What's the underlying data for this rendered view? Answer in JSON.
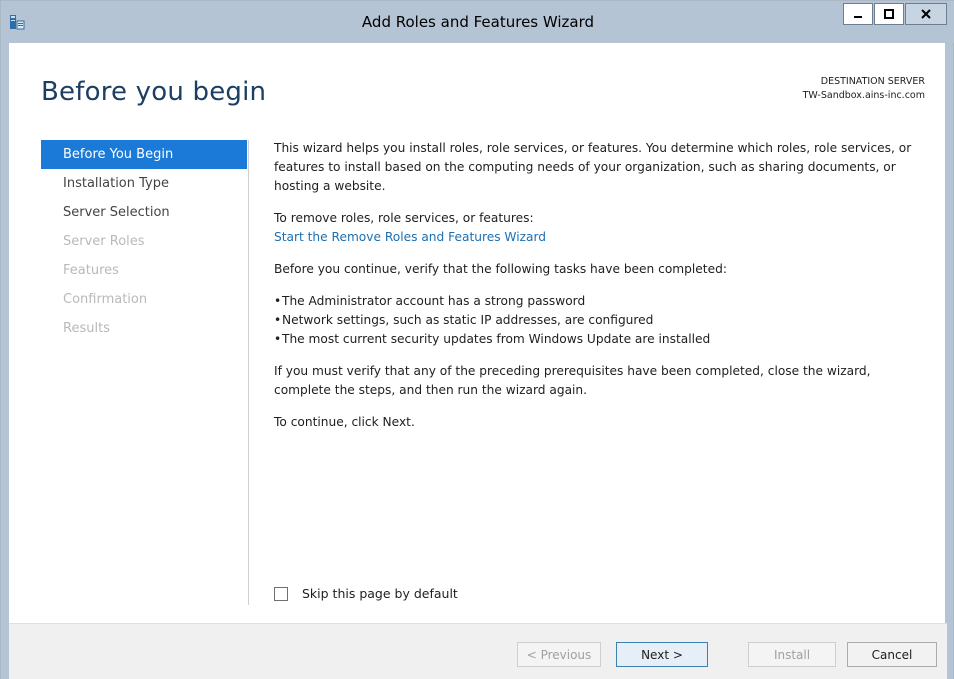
{
  "window": {
    "title": "Add Roles and Features Wizard",
    "controls": {
      "minimize": "minimize",
      "maximize": "maximize",
      "close": "close"
    }
  },
  "page": {
    "title": "Before you begin",
    "destination_label": "DESTINATION SERVER",
    "destination_server": "TW-Sandbox.ains-inc.com"
  },
  "nav": {
    "items": [
      {
        "label": "Before You Begin",
        "state": "active"
      },
      {
        "label": "Installation Type",
        "state": "enabled"
      },
      {
        "label": "Server Selection",
        "state": "enabled"
      },
      {
        "label": "Server Roles",
        "state": "disabled"
      },
      {
        "label": "Features",
        "state": "disabled"
      },
      {
        "label": "Confirmation",
        "state": "disabled"
      },
      {
        "label": "Results",
        "state": "disabled"
      }
    ]
  },
  "content": {
    "intro": "This wizard helps you install roles, role services, or features. You determine which roles, role services, or features to install based on the computing needs of your organization, such as sharing documents, or hosting a website.",
    "remove_heading": "To remove roles, role services, or features:",
    "remove_link": "Start the Remove Roles and Features Wizard",
    "verify_intro": "Before you continue, verify that the following tasks have been completed:",
    "bullet_char": "•",
    "bullets": [
      "The Administrator account has a strong password",
      "Network settings, such as static IP addresses, are configured",
      "The most current security updates from Windows Update are installed"
    ],
    "prereq_note": "If you must verify that any of the preceding prerequisites have been completed, close the wizard, complete the steps, and then run the wizard again.",
    "continue_note": "To continue, click Next."
  },
  "skip": {
    "label": "Skip this page by default",
    "checked": false
  },
  "buttons": {
    "previous": "< Previous",
    "next": "Next >",
    "install": "Install",
    "cancel": "Cancel"
  },
  "colors": {
    "titlebar": "#b4c4d4",
    "accent": "#1b7ad8",
    "title_text": "#1b3f63",
    "link": "#1c6fb1",
    "disabled_text": "#b9b9b9"
  }
}
